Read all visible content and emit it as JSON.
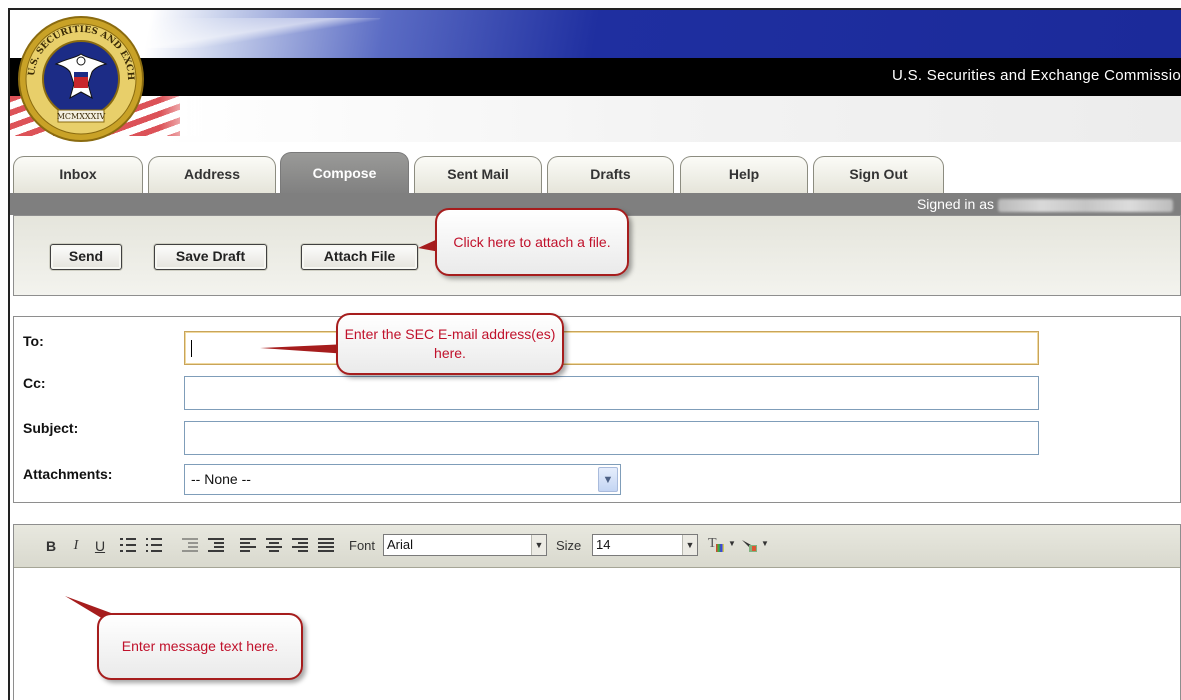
{
  "header": {
    "agency_name": "U.S. Securities and Exchange Commissio",
    "seal_text_top": "AND EXCHANGE",
    "seal_text_left": "U.S. SECURITIES",
    "seal_text_right": "COMMISSION",
    "seal_text_bottom": "MCMXXXIV"
  },
  "tabs": [
    {
      "label": "Inbox",
      "active": false
    },
    {
      "label": "Address",
      "active": false
    },
    {
      "label": "Compose",
      "active": true
    },
    {
      "label": "Sent Mail",
      "active": false
    },
    {
      "label": "Drafts",
      "active": false
    },
    {
      "label": "Help",
      "active": false
    },
    {
      "label": "Sign Out",
      "active": false
    }
  ],
  "session": {
    "signed_in_label": "Signed in as"
  },
  "actions": {
    "send": "Send",
    "save_draft": "Save Draft",
    "attach_file": "Attach File"
  },
  "form": {
    "to_label": "To:",
    "to_value": "",
    "cc_label": "Cc:",
    "cc_value": "",
    "subject_label": "Subject:",
    "subject_value": "",
    "attachments_label": "Attachments:",
    "attachments_selected": "-- None --"
  },
  "editor_toolbar": {
    "bold": "B",
    "italic": "I",
    "underline": "U",
    "font_label": "Font",
    "font_value": "Arial",
    "size_label": "Size",
    "size_value": "14",
    "icons": [
      "bold-icon",
      "italic-icon",
      "underline-icon",
      "numbered-list-icon",
      "bulleted-list-icon",
      "outdent-icon",
      "indent-icon",
      "align-left-icon",
      "align-center-icon",
      "align-right-icon",
      "justify-icon",
      "text-color-icon",
      "highlight-color-icon"
    ]
  },
  "callouts": {
    "attach": "Click here to attach a file.",
    "to": "Enter the SEC E-mail address(es) here.",
    "message": "Enter message text here."
  },
  "colors": {
    "callout_text": "#c0112b",
    "callout_border": "#a61d1d",
    "active_tab": "#808080",
    "banner_blue": "#1b2a9a"
  }
}
